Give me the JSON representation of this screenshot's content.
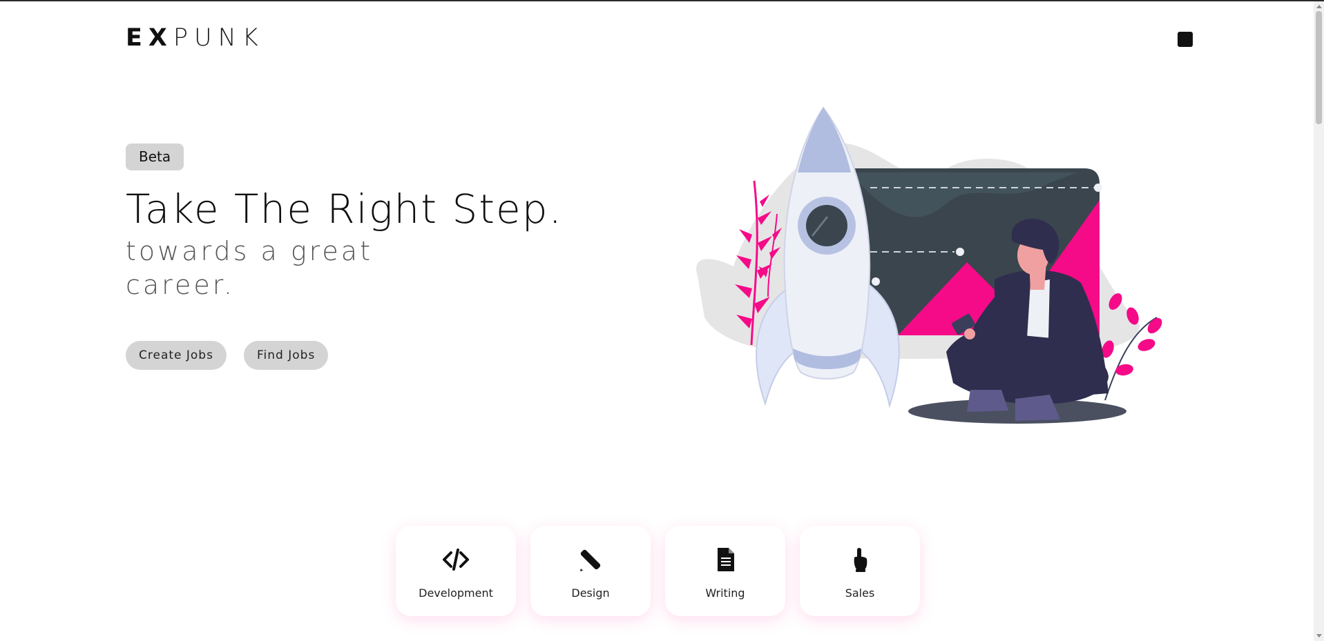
{
  "header": {
    "logo_bold": "EX",
    "logo_light": "PUNK"
  },
  "hero": {
    "badge": "Beta",
    "headline": "Take The Right Step.",
    "subheadline": "towards a great career.",
    "buttons": {
      "create": "Create Jobs",
      "find": "Find Jobs"
    },
    "illustration": "rocket-and-person-illustration"
  },
  "categories": [
    {
      "label": "Development",
      "icon": "code-icon"
    },
    {
      "label": "Design",
      "icon": "pencil-ruler-icon"
    },
    {
      "label": "Writing",
      "icon": "document-icon"
    },
    {
      "label": "Sales",
      "icon": "pointing-hand-icon"
    }
  ],
  "colors": {
    "accent_pink": "#f50a88",
    "dark_slate": "#3a454e",
    "rocket_blue": "#b0bde0",
    "button_gray": "#d4d4d4",
    "card_shadow_pink": "#ff69b4"
  }
}
